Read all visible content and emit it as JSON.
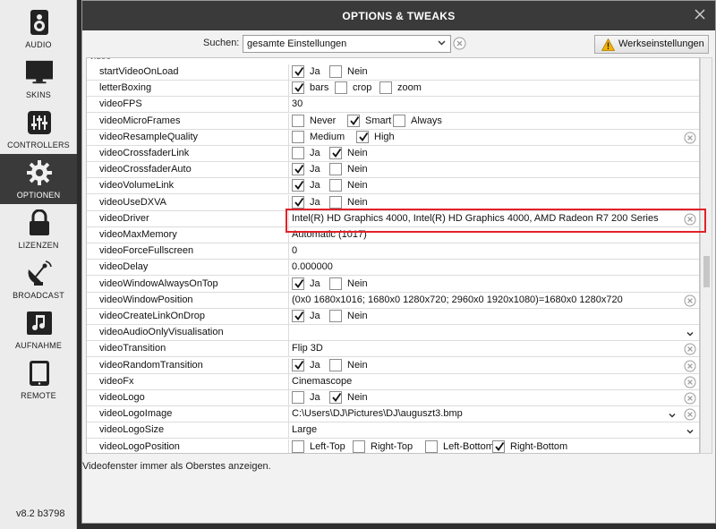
{
  "sidebar": {
    "items": [
      {
        "label": "AUDIO",
        "icon": "speaker-icon"
      },
      {
        "label": "SKINS",
        "icon": "monitor-icon"
      },
      {
        "label": "CONTROLLERS",
        "icon": "mixer-sliders-icon"
      },
      {
        "label": "OPTIONEN",
        "icon": "gear-icon",
        "active": true
      },
      {
        "label": "LIZENZEN",
        "icon": "lock-icon"
      },
      {
        "label": "BROADCAST",
        "icon": "satellite-dish-icon"
      },
      {
        "label": "AUFNAHME",
        "icon": "music-note-icon"
      },
      {
        "label": "REMOTE",
        "icon": "tablet-icon"
      }
    ],
    "version": "v8.2 b3798"
  },
  "dialog": {
    "title": "OPTIONS & TWEAKS",
    "search_label": "Suchen:",
    "search_value": "gesamte Einstellungen",
    "defaults_button": "Werkseinstellungen",
    "section": "video",
    "description": "Videofenster immer als Oberstes anzeigen.",
    "rows": [
      {
        "key": "startVideoOnLoad",
        "type": "options",
        "options": [
          {
            "label": "Ja",
            "checked": true
          },
          {
            "label": "Nein",
            "checked": false
          }
        ]
      },
      {
        "key": "letterBoxing",
        "type": "options",
        "options": [
          {
            "label": "bars",
            "checked": true
          },
          {
            "label": "crop",
            "checked": false
          },
          {
            "label": "zoom",
            "checked": false
          }
        ]
      },
      {
        "key": "videoFPS",
        "type": "text",
        "value": "30"
      },
      {
        "key": "videoMicroFrames",
        "type": "options",
        "options": [
          {
            "label": "Never",
            "checked": false
          },
          {
            "label": "Smart",
            "checked": true
          },
          {
            "label": "Always",
            "checked": false
          }
        ]
      },
      {
        "key": "videoResampleQuality",
        "type": "options",
        "options": [
          {
            "label": "Medium",
            "checked": false
          },
          {
            "label": "High",
            "checked": true
          }
        ],
        "action": "clear"
      },
      {
        "key": "videoCrossfaderLink",
        "type": "options",
        "options": [
          {
            "label": "Ja",
            "checked": false
          },
          {
            "label": "Nein",
            "checked": true
          }
        ]
      },
      {
        "key": "videoCrossfaderAuto",
        "type": "options",
        "options": [
          {
            "label": "Ja",
            "checked": true
          },
          {
            "label": "Nein",
            "checked": false
          }
        ]
      },
      {
        "key": "videoVolumeLink",
        "type": "options",
        "options": [
          {
            "label": "Ja",
            "checked": true
          },
          {
            "label": "Nein",
            "checked": false
          }
        ]
      },
      {
        "key": "videoUseDXVA",
        "type": "options",
        "options": [
          {
            "label": "Ja",
            "checked": true
          },
          {
            "label": "Nein",
            "checked": false
          }
        ]
      },
      {
        "key": "videoDriver",
        "type": "text",
        "value": "Intel(R) HD Graphics 4000, Intel(R) HD Graphics 4000, AMD Radeon R7 200 Series",
        "action": "clear"
      },
      {
        "key": "videoMaxMemory",
        "type": "text",
        "value": "Automatic (1017)"
      },
      {
        "key": "videoForceFullscreen",
        "type": "text",
        "value": "0"
      },
      {
        "key": "videoDelay",
        "type": "text",
        "value": "0.000000"
      },
      {
        "key": "videoWindowAlwaysOnTop",
        "type": "options",
        "options": [
          {
            "label": "Ja",
            "checked": true
          },
          {
            "label": "Nein",
            "checked": false
          }
        ]
      },
      {
        "key": "videoWindowPosition",
        "type": "text",
        "value": "(0x0 1680x1016; 1680x0 1280x720; 2960x0 1920x1080)=1680x0 1280x720",
        "action": "clear"
      },
      {
        "key": "videoCreateLinkOnDrop",
        "type": "options",
        "options": [
          {
            "label": "Ja",
            "checked": true
          },
          {
            "label": "Nein",
            "checked": false
          }
        ]
      },
      {
        "key": "videoAudioOnlyVisualisation",
        "type": "text",
        "value": "",
        "action": "dropdown"
      },
      {
        "key": "videoTransition",
        "type": "text",
        "value": "Flip 3D",
        "action": "clear"
      },
      {
        "key": "videoRandomTransition",
        "type": "options",
        "options": [
          {
            "label": "Ja",
            "checked": true
          },
          {
            "label": "Nein",
            "checked": false
          }
        ],
        "action": "clear"
      },
      {
        "key": "videoFx",
        "type": "text",
        "value": "Cinemascope",
        "action": "clear"
      },
      {
        "key": "videoLogo",
        "type": "options",
        "options": [
          {
            "label": "Ja",
            "checked": false
          },
          {
            "label": "Nein",
            "checked": true
          }
        ],
        "action": "clear"
      },
      {
        "key": "videoLogoImage",
        "type": "text",
        "value": "C:\\Users\\DJ\\Pictures\\DJ\\auguszt3.bmp",
        "action": "dropdown-clear"
      },
      {
        "key": "videoLogoSize",
        "type": "text",
        "value": "Large",
        "action": "dropdown"
      },
      {
        "key": "videoLogoPosition",
        "type": "options",
        "options": [
          {
            "label": "Left-Top",
            "checked": false
          },
          {
            "label": "Right-Top",
            "checked": false
          },
          {
            "label": "Left-Bottom",
            "checked": false
          },
          {
            "label": "Right-Bottom",
            "checked": true
          }
        ]
      }
    ]
  },
  "colors": {
    "highlight": "#e2212b",
    "titlebar": "#3a3a3a",
    "active_nav": "#3a3a3a"
  }
}
